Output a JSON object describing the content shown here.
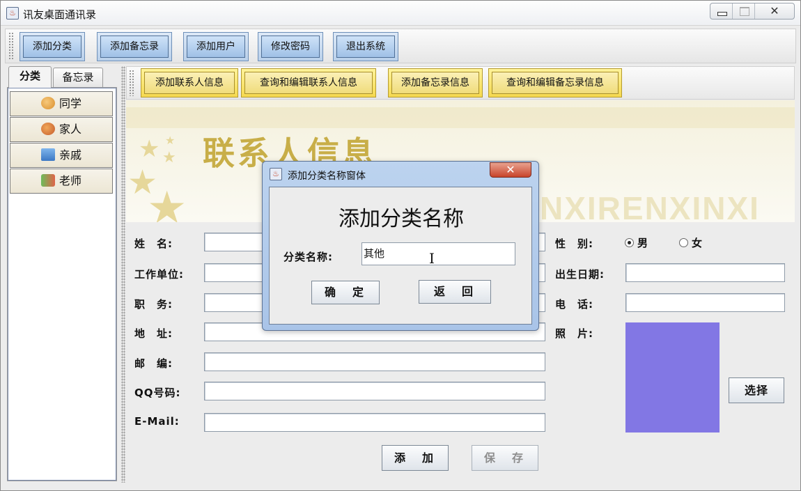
{
  "window": {
    "title": "讯友桌面通讯录",
    "controls": [
      "minimize",
      "maximize",
      "close"
    ]
  },
  "main_toolbar": {
    "buttons": [
      "添加分类",
      "添加备忘录",
      "添加用户",
      "修改密码",
      "退出系统"
    ]
  },
  "left_tabs": {
    "tabs": [
      "分类",
      "备忘录"
    ],
    "categories": [
      {
        "label": "同学",
        "icon": "person-icon"
      },
      {
        "label": "家人",
        "icon": "family-icon"
      },
      {
        "label": "亲戚",
        "icon": "relatives-icon"
      },
      {
        "label": "老师",
        "icon": "teacher-icon"
      }
    ]
  },
  "sub_toolbar": {
    "buttons": [
      "添加联系人信息",
      "查询和编辑联系人信息",
      "添加备忘录信息",
      "查询和编辑备忘录信息"
    ]
  },
  "banner": {
    "title": "联系人信息",
    "subtitle": "NXIRENXINXI"
  },
  "form": {
    "name_label": "姓　名:",
    "work_label": "工作单位:",
    "position_label": "职　务:",
    "address_label": "地　址:",
    "zip_label": "邮　编:",
    "qq_label": "QQ号码:",
    "email_label": "E-Mail:",
    "gender_label": "性　别:",
    "gender_options": [
      "男",
      "女"
    ],
    "gender_selected": "男",
    "birth_label": "出生日期:",
    "phone_label": "电　话:",
    "photo_label": "照　片:",
    "choose_button": "选择",
    "add_button": "添　加",
    "save_button": "保　存",
    "photo_color": "#8277e4"
  },
  "dialog": {
    "title": "添加分类名称窗体",
    "heading": "添加分类名称",
    "field_label": "分类名称:",
    "field_value": "其他",
    "ok_button": "确　定",
    "back_button": "返　回",
    "close_symbol": "✕"
  },
  "colors": {
    "blue_button": "#b9d0ea",
    "yellow_button": "#f5d94f",
    "banner_title": "#c8ae48"
  }
}
